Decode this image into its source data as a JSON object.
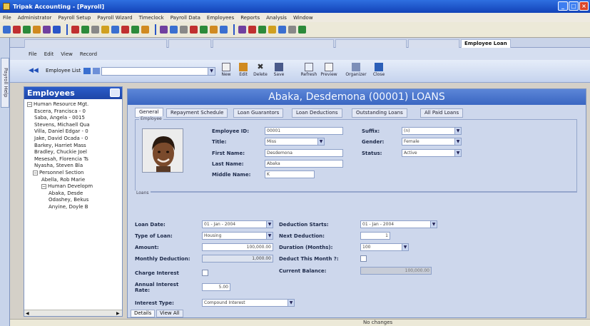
{
  "window": {
    "title": "Tripak Accounting - [Payroll]"
  },
  "menubar": [
    "File",
    "Administrator",
    "Payroll Setup",
    "Payroll Wizard",
    "Timeclock",
    "Payroll Data",
    "Employees",
    "Reports",
    "Analysis",
    "Window"
  ],
  "toolbar1_icons": [
    "#3a6fd0",
    "#c03030",
    "#2c8a3a",
    "#d08a20",
    "#7040a0",
    "#2a56c8",
    "#c03030",
    "#2c8a3a",
    "#888888",
    "#d0a020",
    "#3a6fd0",
    "#c03030",
    "#2c8a3a",
    "#d08a20",
    "#7040a0",
    "#3a6fd0",
    "#888888",
    "#c03030",
    "#2c8a3a",
    "#d08a20",
    "#3a6fd0",
    "#7040a0",
    "#c03030",
    "#2c8a3a",
    "#d0a020",
    "#3a6fd0",
    "#888888",
    "#2c8a3a"
  ],
  "leftstrip": {
    "label": "Payroll Help"
  },
  "mditabs": {
    "active": "Employee Loan"
  },
  "submenu": [
    "File",
    "Edit",
    "View",
    "Record"
  ],
  "toolbar2": {
    "search_label": "Employee List",
    "buttons": [
      "New",
      "Edit",
      "Delete",
      "Save",
      "Refresh",
      "Preview",
      "Organizer",
      "Close"
    ]
  },
  "sidebar": {
    "title": "Employees",
    "items": [
      {
        "text": "Human Resource Mgt.",
        "sym": "−"
      },
      {
        "text": "Escera, Francisca - 0",
        "sym": ""
      },
      {
        "text": "Saba, Angela - 0015",
        "sym": ""
      },
      {
        "text": "Stevens, Michaell Qua",
        "sym": ""
      },
      {
        "text": "Villa, Daniel Edgar - 0",
        "sym": ""
      },
      {
        "text": "Jake, David Ocada - 0",
        "sym": ""
      },
      {
        "text": "Barkey, Harriet Mass",
        "sym": ""
      },
      {
        "text": "Bradley, Chuckie Joel",
        "sym": ""
      },
      {
        "text": "Mesesah, Florencia Ts",
        "sym": ""
      },
      {
        "text": "Nyasha, Steven Bla",
        "sym": ""
      },
      {
        "text": "Personnel Section",
        "sym": "−"
      },
      {
        "text": "Abella, Rob Marie",
        "sym": ""
      },
      {
        "text": "Human Developm",
        "sym": "−"
      },
      {
        "text": "Abaka, Desde",
        "sym": ""
      },
      {
        "text": "Odashey, Bekus",
        "sym": ""
      },
      {
        "text": "Anyine, Doyle B",
        "sym": ""
      }
    ]
  },
  "main": {
    "header": "Abaka, Desdemona (00001) LOANS",
    "tabs": [
      "General",
      "Repayment Schedule",
      "Loan Guarantors",
      "Loan Deductions",
      "Outstanding Loans",
      "All Paid Loans"
    ],
    "employee_frame_label": "Employee",
    "loan_frame_label": "Loans",
    "employee": {
      "labels": {
        "id": "Employee ID:",
        "title": "Title:",
        "first": "First Name:",
        "last": "Last Name:",
        "middle": "Middle Name:",
        "suffix": "Suffix:",
        "gender": "Gender:",
        "status": "Status:"
      },
      "values": {
        "id": "00001",
        "title": "Miss",
        "first": "Desdemona",
        "last": "Abaka",
        "middle": "K",
        "suffix": "(n)",
        "gender": "Female",
        "status": "Active"
      }
    },
    "loan": {
      "labels": {
        "loan_date": "Loan Date:",
        "type": "Type of Loan:",
        "amount": "Amount:",
        "monthly": "Monthly Deduction:",
        "charge_interest": "Charge Interest",
        "annual_rate": "Annual Interest Rate:",
        "interest_type": "Interest Type:",
        "ded_starts": "Deduction Starts:",
        "next_ded": "Next Deduction:",
        "duration": "Duration (Months):",
        "deduct_month": "Deduct This Month ?:",
        "current_balance": "Current Balance:"
      },
      "values": {
        "loan_date": "01 - Jan - 2004",
        "type": "Housing",
        "amount": "100,000.00",
        "monthly": "1,000.00",
        "annual_rate": "5.00",
        "interest_type": "Compound Interest",
        "ded_starts": "01 - Jan - 2004",
        "next_ded": "1",
        "duration": "100",
        "current_balance": "100,000.00"
      }
    },
    "bottom_tabs": [
      "Details",
      "View All"
    ]
  },
  "status": {
    "text": "No changes"
  }
}
